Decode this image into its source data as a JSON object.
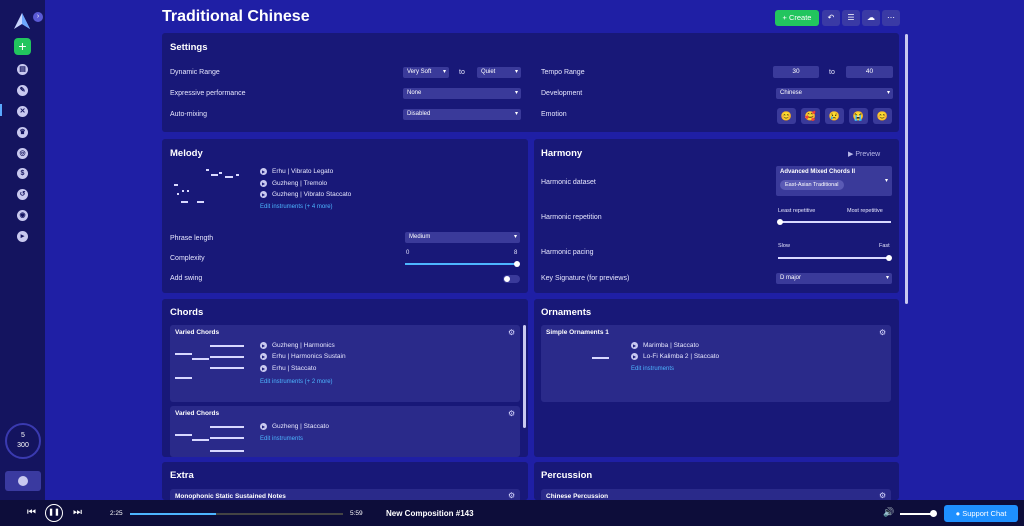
{
  "page": {
    "title": "Traditional Chinese"
  },
  "header": {
    "create_label": "Create"
  },
  "settings": {
    "title": "Settings",
    "dynamic_range": {
      "label": "Dynamic Range",
      "from": "Very Soft",
      "to_word": "to",
      "to": "Quiet"
    },
    "expressive": {
      "label": "Expressive performance",
      "value": "None"
    },
    "automixing": {
      "label": "Auto-mixing",
      "value": "Disabled"
    },
    "tempo": {
      "label": "Tempo Range",
      "from": "30",
      "to_word": "to",
      "to": "40"
    },
    "development": {
      "label": "Development",
      "value": "Chinese"
    },
    "emotion": {
      "label": "Emotion",
      "emojis": [
        "😊",
        "🥰",
        "😢",
        "😭",
        "😊"
      ]
    }
  },
  "melody": {
    "title": "Melody",
    "instruments": [
      "Erhu | Vibrato Legato",
      "Guzheng | Tremolo",
      "Guzheng | Vibrato Staccato"
    ],
    "edit_link": "Edit instruments (+ 4 more)",
    "phrase_length": {
      "label": "Phrase length",
      "value": "Medium"
    },
    "complexity": {
      "label": "Complexity",
      "min": "0",
      "max": "8",
      "value": 8
    },
    "swing": {
      "label": "Add swing",
      "enabled": false
    }
  },
  "harmony": {
    "title": "Harmony",
    "preview_label": "Preview",
    "dataset": {
      "label": "Harmonic dataset",
      "value": "Advanced Mixed Chords II",
      "tag": "East-Asian Traditional"
    },
    "repetition": {
      "label": "Harmonic repetition",
      "min_label": "Least repetitive",
      "max_label": "Most repetitive",
      "value": 0
    },
    "pacing": {
      "label": "Harmonic pacing",
      "min_label": "Slow",
      "max_label": "Fast",
      "value": 1
    },
    "key": {
      "label": "Key Signature (for previews)",
      "value": "D major"
    }
  },
  "chords": {
    "title": "Chords",
    "blocks": [
      {
        "title": "Varied Chords",
        "instruments": [
          "Guzheng | Harmonics",
          "Erhu | Harmonics Sustain",
          "Erhu | Staccato"
        ],
        "edit_link": "Edit instruments (+ 2 more)"
      },
      {
        "title": "Varied Chords",
        "instruments": [
          "Guzheng | Staccato"
        ],
        "edit_link": "Edit instruments"
      }
    ]
  },
  "ornaments": {
    "title": "Ornaments",
    "block": {
      "title": "Simple Ornaments 1",
      "instruments": [
        "Marimba | Staccato",
        "Lo-Fi Kalimba 2 | Staccato"
      ],
      "edit_link": "Edit instruments"
    }
  },
  "extra": {
    "title": "Extra",
    "block_title": "Monophonic Static Sustained Notes"
  },
  "percussion": {
    "title": "Percussion",
    "block_title": "Chinese Percussion"
  },
  "sidebar": {
    "credits_top": "5",
    "credits_bottom": "300"
  },
  "player": {
    "elapsed": "2:25",
    "duration": "5:59",
    "song": "New Composition #143",
    "progress": 0.405,
    "volume": 1
  },
  "support_label": "Support Chat"
}
